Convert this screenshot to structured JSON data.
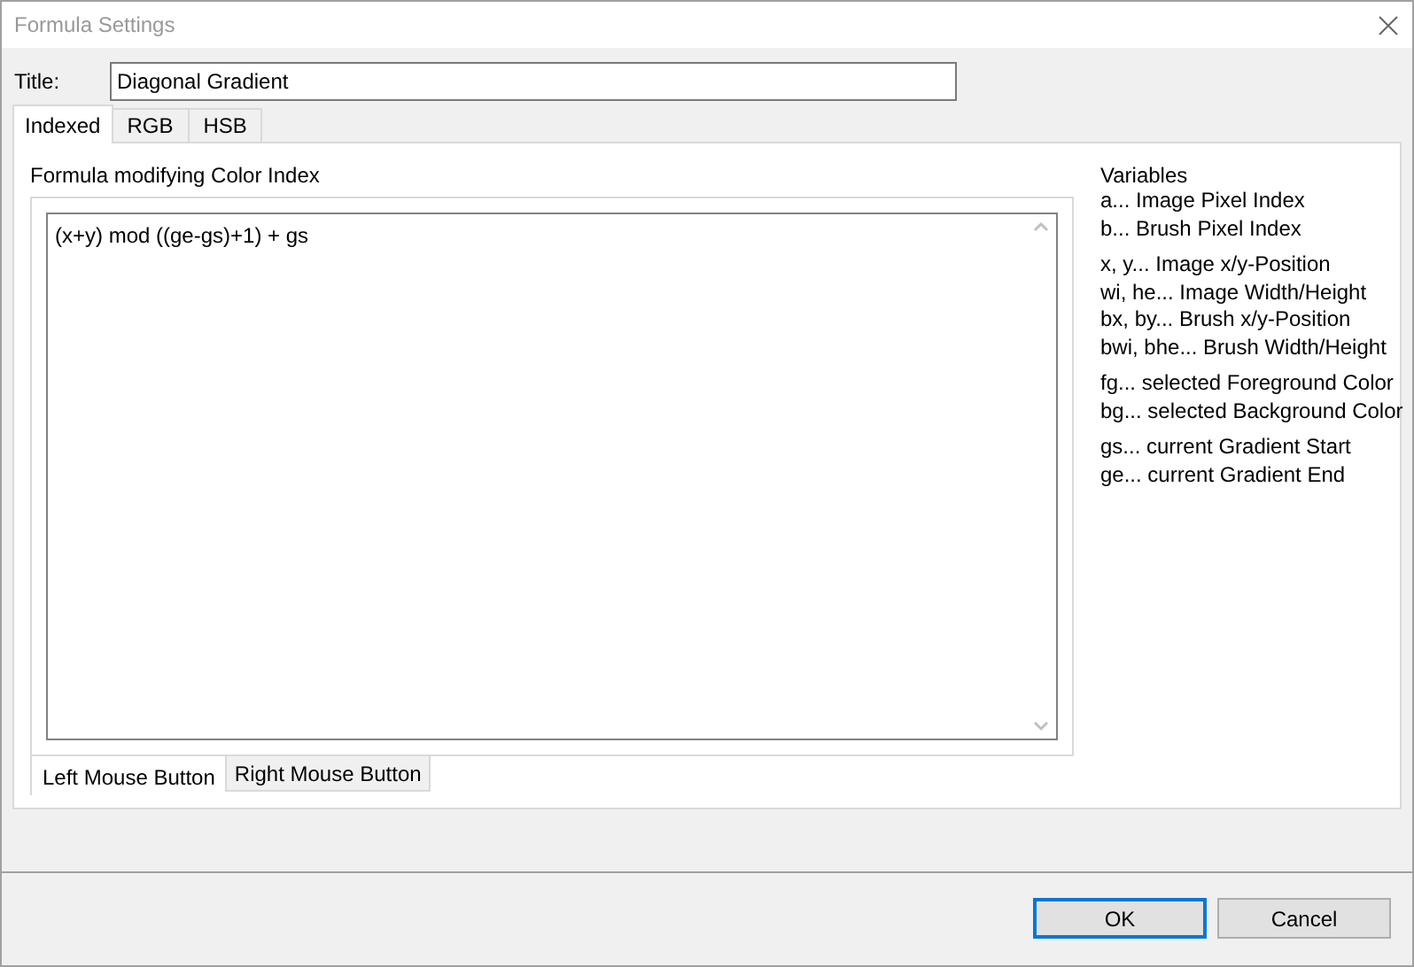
{
  "window": {
    "title": "Formula Settings"
  },
  "title_field": {
    "label": "Title:",
    "value": "Diagonal Gradient"
  },
  "tabs": [
    {
      "label": "Indexed",
      "selected": true
    },
    {
      "label": "RGB",
      "selected": false
    },
    {
      "label": "HSB",
      "selected": false
    }
  ],
  "formula": {
    "label": "Formula modifying Color Index",
    "value": "(x+y) mod ((ge-gs)+1) + gs"
  },
  "mouse_tabs": [
    {
      "label": "Left Mouse Button",
      "selected": true
    },
    {
      "label": "Right Mouse Button",
      "selected": false
    }
  ],
  "variables": {
    "heading": "Variables",
    "groups": [
      [
        "a... Image Pixel Index",
        "b... Brush Pixel Index"
      ],
      [
        "x, y... Image x/y-Position",
        "wi, he... Image Width/Height",
        "bx, by... Brush x/y-Position",
        "bwi, bhe... Brush Width/Height"
      ],
      [
        "fg... selected Foreground Color",
        "bg... selected Background Color"
      ],
      [
        "gs... current Gradient Start",
        "ge... current Gradient End"
      ]
    ]
  },
  "buttons": [
    {
      "label": "OK",
      "selected": true
    },
    {
      "label": "Cancel",
      "selected": false
    }
  ]
}
